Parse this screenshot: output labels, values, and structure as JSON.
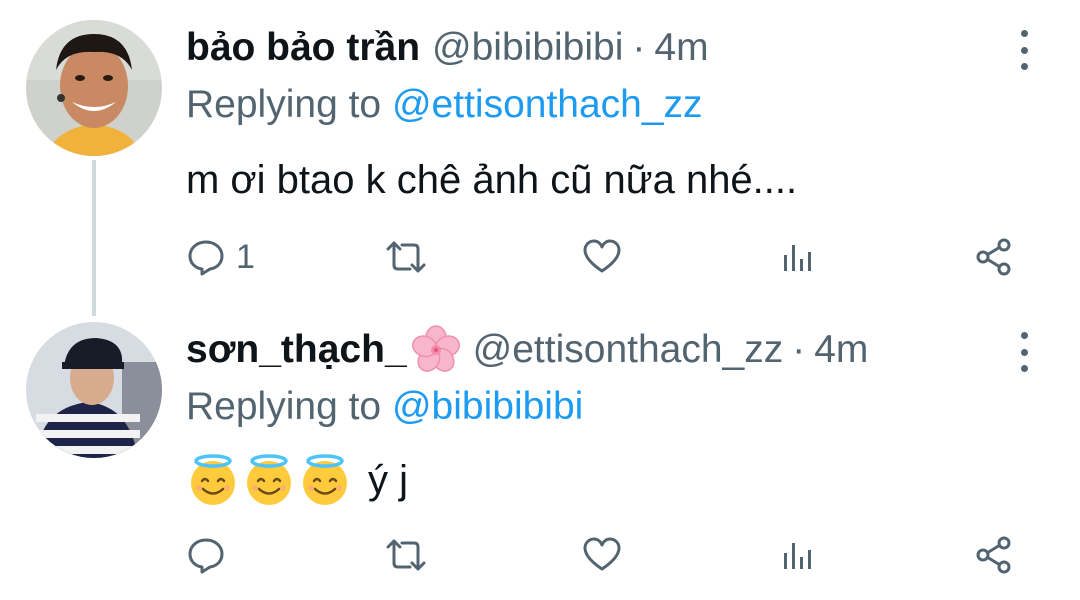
{
  "replies": [
    {
      "display_name": "bảo bảo trần",
      "handle": "@bibibibibi",
      "separator": "·",
      "time": "4m",
      "replying_prefix": "Replying to ",
      "replying_to": "@ettisonthach_zz",
      "text": "m ơi btao k chê ảnh cũ nữa nhé....",
      "reply_count": "1",
      "avatar_icon": "user-avatar-smiling-man"
    },
    {
      "display_name": "sơn_thạch_",
      "name_emoji": "cherry-blossom-icon",
      "handle": "@ettisonthach_zz",
      "separator": "·",
      "time": "4m",
      "replying_prefix": "Replying to ",
      "replying_to": "@bibibibibi",
      "text": "ý j",
      "emojis": [
        "smiling-face-with-halo-icon",
        "smiling-face-with-halo-icon",
        "smiling-face-with-halo-icon"
      ],
      "reply_count": "",
      "avatar_icon": "user-avatar-striped-shirt"
    }
  ],
  "colors": {
    "text": "#0f1419",
    "secondary": "#536471",
    "link": "#1d9bf0",
    "thread_line": "#cfd9de"
  }
}
